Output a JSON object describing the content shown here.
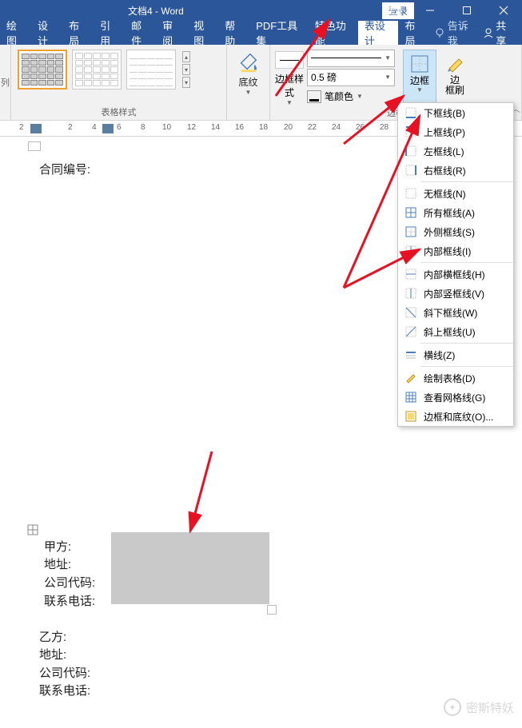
{
  "titlebar": {
    "title": "文档4  -  Word",
    "login": "登录"
  },
  "tabs": [
    "绘图",
    "设计",
    "布局",
    "引用",
    "邮件",
    "审阅",
    "视图",
    "帮助",
    "PDF工具集",
    "特色功能",
    "表设计",
    "布局"
  ],
  "active_tab_index": 10,
  "tell_me": "告诉我",
  "share": "共享",
  "ribbon": {
    "styles_group_label": "表格样式",
    "shading_label": "底纹",
    "border_style_label": "边框样\n式",
    "line_weight": "0.5 磅",
    "pen_color_label": "笔颜色",
    "borders_btn": "边框",
    "border_painter": "边\n框刷",
    "border_group_label": "边框"
  },
  "ruler_nums": [
    "2",
    "2",
    "4",
    "6",
    "8",
    "10",
    "12",
    "14",
    "16",
    "18",
    "20",
    "22",
    "24",
    "26",
    "28"
  ],
  "doc": {
    "contract_no": "合同编号:",
    "party_a": "甲方:",
    "addr1": "地址:",
    "code1": "公司代码:",
    "phone1": "联系电话:",
    "party_b": "乙方:",
    "addr2": "地址:",
    "code2": "公司代码:",
    "phone2": "联系电话:"
  },
  "dropdown": [
    {
      "label": "下框线(B)",
      "sep": false
    },
    {
      "label": "上框线(P)",
      "sep": false
    },
    {
      "label": "左框线(L)",
      "sep": false
    },
    {
      "label": "右框线(R)",
      "sep": true
    },
    {
      "label": "无框线(N)",
      "sep": false
    },
    {
      "label": "所有框线(A)",
      "sep": false
    },
    {
      "label": "外侧框线(S)",
      "sep": false
    },
    {
      "label": "内部框线(I)",
      "sep": true
    },
    {
      "label": "内部横框线(H)",
      "sep": false
    },
    {
      "label": "内部竖框线(V)",
      "sep": false
    },
    {
      "label": "斜下框线(W)",
      "sep": false
    },
    {
      "label": "斜上框线(U)",
      "sep": true
    },
    {
      "label": "横线(Z)",
      "sep": true
    },
    {
      "label": "绘制表格(D)",
      "sep": false
    },
    {
      "label": "查看网格线(G)",
      "sep": false
    },
    {
      "label": "边框和底纹(O)...",
      "sep": false
    }
  ],
  "watermark": "密斯特妖"
}
